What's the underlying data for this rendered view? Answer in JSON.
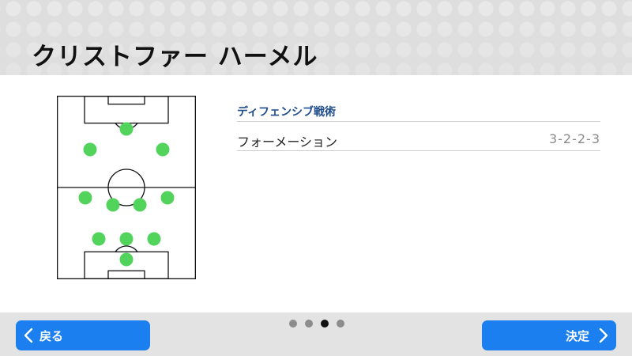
{
  "header": {
    "player_name": "クリストファー ハーメル"
  },
  "tactics": {
    "section_title": "ディフェンシブ戦術",
    "rows": [
      {
        "label": "フォーメーション",
        "value": "3-2-2-3"
      }
    ]
  },
  "pitch": {
    "formation": "3-2-2-3",
    "marker_color": "#52d45c",
    "line_color": "#111111"
  },
  "pagination": {
    "total": 4,
    "current": 3
  },
  "footer": {
    "back_label": "戻る",
    "confirm_label": "決定"
  },
  "colors": {
    "accent": "#1b7ff0",
    "section_title": "#1e4c8c"
  },
  "icons": {
    "back": "chevron-left-icon",
    "confirm": "chevron-right-icon"
  }
}
